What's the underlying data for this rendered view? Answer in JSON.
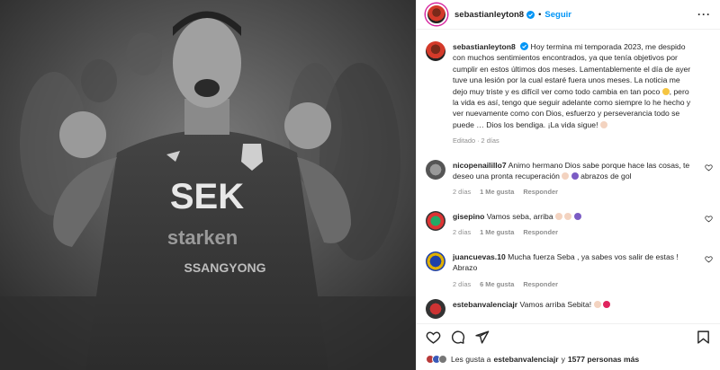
{
  "post": {
    "username": "sebastianleyton8",
    "follow_label": "Seguir",
    "dot": "•",
    "more_icon": "more-horizontal-icon"
  },
  "caption": {
    "username": "sebastianleyton8",
    "text": "Hoy termina mi temporada 2023, me despido con muchos sentimientos encontrados, ya que tenía objetivos por cumplir en estos últimos dos meses. Lamentablemente el día de ayer tuve una lesión por la cual estaré fuera unos meses. La noticia me dejo muy triste y es difícil ver como todo cambia en tan poco",
    "text2": ", pero la vida es así, tengo que seguir adelante como siempre lo he hecho y ver nuevamente como con Dios, esfuerzo y perseverancia todo se puede … Dios los bendiga. ¡La vida sigue!",
    "edited_label": "Editado",
    "time": "2 días"
  },
  "comments": [
    {
      "username": "nicopenailillo7",
      "text": "Animo hermano Dios sabe porque hace las cosas, te deseo una pronta recuperación",
      "text_tail": "abrazos de gol",
      "time": "2 días",
      "likes": "1 Me gusta",
      "reply": "Responder"
    },
    {
      "username": "gisepino",
      "text": "Vamos seba, arriba",
      "text_tail": "",
      "time": "2 días",
      "likes": "1 Me gusta",
      "reply": "Responder"
    },
    {
      "username": "juancuevas.10",
      "text": "Mucha fuerza Seba , ya sabes vos salir de estas ! Abrazo",
      "text_tail": "",
      "time": "2 días",
      "likes": "6 Me gusta",
      "reply": "Responder"
    },
    {
      "username": "estebanvalenciajr",
      "text": "Vamos arriba Sebita!",
      "text_tail": "",
      "time": "",
      "likes": "",
      "reply": ""
    }
  ],
  "likes_line": {
    "prefix": "Les gusta a",
    "user": "estebanvalenciajr",
    "middle": "y",
    "count": "1577 personas más"
  },
  "photo_text": {
    "sponsor": "SEK",
    "sponsor2": "starken",
    "sponsor3": "SSANGYONG"
  },
  "colors": {
    "accent": "#0095f6",
    "muted": "#8e8e8e",
    "text": "#262626"
  }
}
